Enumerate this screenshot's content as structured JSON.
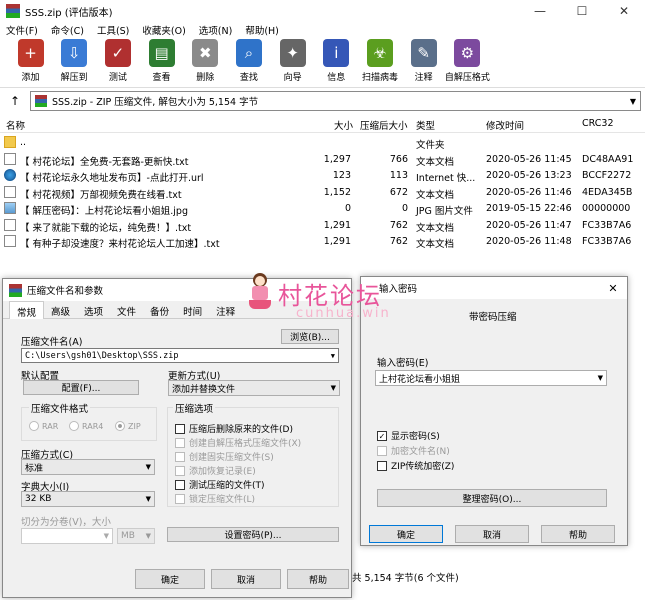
{
  "window": {
    "title": "SSS.zip (评估版本)",
    "min": "—",
    "max": "☐",
    "close": "✕"
  },
  "menu": [
    "文件(F)",
    "命令(C)",
    "工具(S)",
    "收藏夹(O)",
    "选项(N)",
    "帮助(H)"
  ],
  "toolbar": [
    {
      "label": "添加",
      "icon": "add-archive-icon",
      "color": "#c0392b"
    },
    {
      "label": "解压到",
      "icon": "extract-folder-icon",
      "color": "#3a7bd5"
    },
    {
      "label": "测试",
      "icon": "test-clipboard-icon",
      "color": "#b03030"
    },
    {
      "label": "查看",
      "icon": "view-book-icon",
      "color": "#2e7d32"
    },
    {
      "label": "删除",
      "icon": "delete-trash-icon",
      "color": "#8a8a8a"
    },
    {
      "label": "查找",
      "icon": "find-magnifier-icon",
      "color": "#2f73c9"
    },
    {
      "label": "向导",
      "icon": "wizard-wand-icon",
      "color": "#666"
    },
    {
      "label": "信息",
      "icon": "info-icon",
      "color": "#3557b7"
    },
    {
      "label": "扫描病毒",
      "icon": "virus-scan-icon",
      "color": "#5b9e1f"
    },
    {
      "label": "注释",
      "icon": "comment-icon",
      "color": "#5a6f8a"
    },
    {
      "label": "自解压格式",
      "icon": "sfx-icon",
      "color": "#7c4a9e"
    }
  ],
  "address": {
    "up": "↑",
    "text": "SSS.zip - ZIP 压缩文件, 解包大小为 5,154 字节",
    "dd": "▼"
  },
  "columns": {
    "name": "名称",
    "size": "大小",
    "packed": "压缩后大小",
    "type": "类型",
    "modified": "修改时间",
    "crc": "CRC32"
  },
  "files": [
    {
      "name": "..",
      "size": "",
      "packed": "",
      "type": "文件夹",
      "modified": "",
      "crc": "",
      "icon": "folder-icon"
    },
    {
      "name": "【 村花论坛】全免费-无套路-更新快.txt",
      "size": "1,297",
      "packed": "766",
      "type": "文本文档",
      "modified": "2020-05-26 11:45",
      "crc": "DC48AA91",
      "icon": "text-file-icon"
    },
    {
      "name": "【 村花论坛永久地址发布页】-点此打开.url",
      "size": "123",
      "packed": "113",
      "type": "Internet 快...",
      "modified": "2020-05-26 13:23",
      "crc": "BCCF2272",
      "icon": "url-file-icon"
    },
    {
      "name": "【 村花视频】万部视频免费在线看.txt",
      "size": "1,152",
      "packed": "672",
      "type": "文本文档",
      "modified": "2020-05-26 11:46",
      "crc": "4EDA345B",
      "icon": "text-file-icon"
    },
    {
      "name": "【 解压密码】：上村花论坛看小姐姐.jpg",
      "size": "0",
      "packed": "0",
      "type": "JPG 图片文件",
      "modified": "2019-05-15 22:46",
      "crc": "00000000",
      "icon": "image-file-icon"
    },
    {
      "name": "【 来了就能下载的论坛，纯免费！】.txt",
      "size": "1,291",
      "packed": "762",
      "type": "文本文档",
      "modified": "2020-05-26 11:47",
      "crc": "FC33B7A6",
      "icon": "text-file-icon"
    },
    {
      "name": "【 有种子却没速度？来村花论坛人工加速】.txt",
      "size": "1,291",
      "packed": "762",
      "type": "文本文档",
      "modified": "2020-05-26 11:48",
      "crc": "FC33B7A6",
      "icon": "text-file-icon"
    }
  ],
  "status": "共 5,154 字节(6 个文件)",
  "compress": {
    "title": "压缩文件名和参数",
    "tabs": [
      "常规",
      "高级",
      "选项",
      "文件",
      "备份",
      "时间",
      "注释"
    ],
    "archive_label": "压缩文件名(A)",
    "browse": "浏览(B)...",
    "archive_value": "C:\\Users\\gsh01\\Desktop\\SSS.zip",
    "profile_label": "默认配置",
    "profile_btn": "配置(F)...",
    "update_label": "更新方式(U)",
    "update_value": "添加并替换文件",
    "format_label": "压缩文件格式",
    "formats": [
      "RAR",
      "RAR4",
      "ZIP"
    ],
    "method_label": "压缩方式(C)",
    "method_value": "标准",
    "dict_label": "字典大小(I)",
    "dict_value": "32 KB",
    "split_label": "切分为分卷(V)，大小",
    "split_unit": "MB",
    "options_label": "压缩选项",
    "options": [
      {
        "text": "压缩后删除原来的文件(D)",
        "enabled": true
      },
      {
        "text": "创建自解压格式压缩文件(X)",
        "enabled": false
      },
      {
        "text": "创建固实压缩文件(S)",
        "enabled": false
      },
      {
        "text": "添加恢复记录(E)",
        "enabled": false
      },
      {
        "text": "测试压缩的文件(T)",
        "enabled": true
      },
      {
        "text": "锁定压缩文件(L)",
        "enabled": false
      }
    ],
    "set_password": "设置密码(P)...",
    "ok": "确定",
    "cancel": "取消",
    "help": "帮助"
  },
  "password": {
    "title": "输入密码",
    "heading": "带密码压缩",
    "input_label": "输入密码(E)",
    "input_value": "上村花论坛看小姐姐",
    "show_password": "显示密码(S)",
    "encrypt_names": "加密文件名(N)",
    "zip_legacy": "ZIP传统加密(Z)",
    "organize": "整理密码(O)...",
    "ok": "确定",
    "cancel": "取消",
    "help": "帮助"
  },
  "watermark": {
    "cn": "村花论坛",
    "en": "cunhua.win"
  }
}
